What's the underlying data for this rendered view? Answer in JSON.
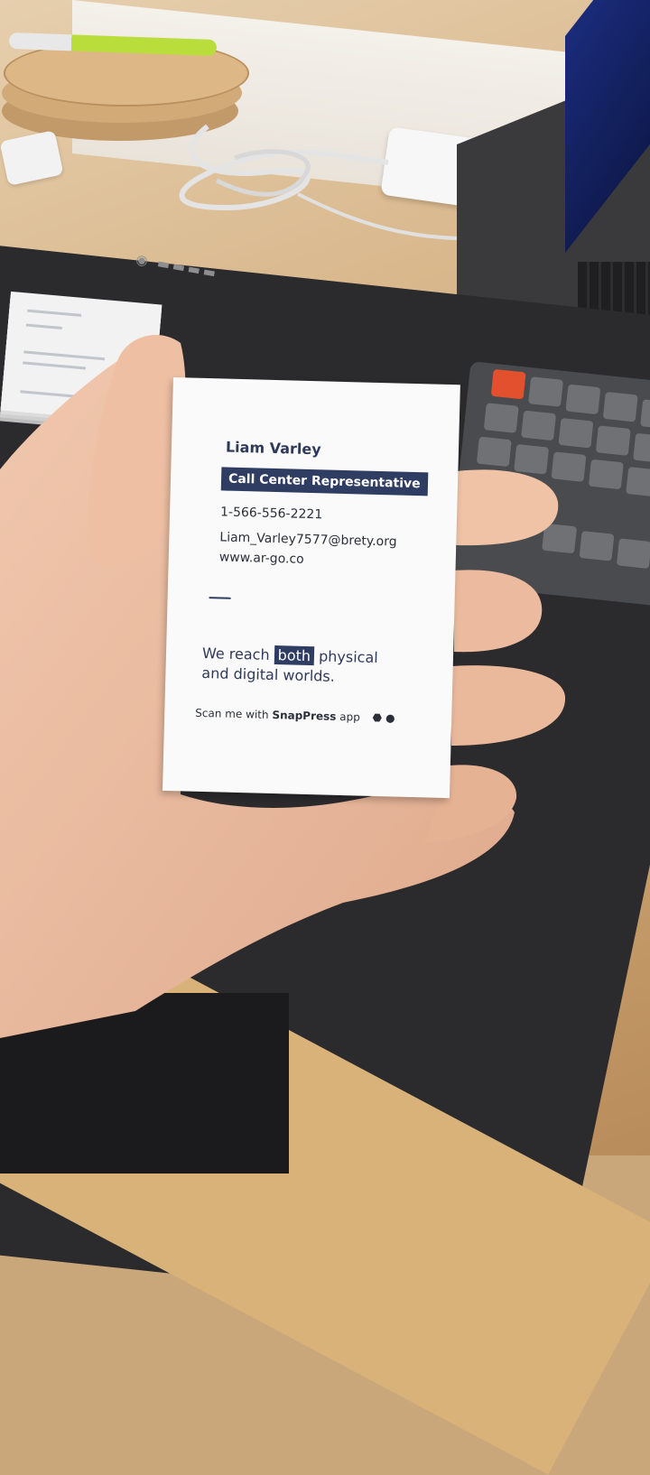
{
  "card": {
    "name": "Liam Varley",
    "title": "Call Center Representative",
    "phone": "1-566-556-2221",
    "email": "Liam_Varley7577@brety.org",
    "website": "www.ar-go.co",
    "tagline_before": "We reach",
    "tagline_highlight": "both",
    "tagline_after_line1": "physical",
    "tagline_line2": "and digital worlds.",
    "scan_prefix": "Scan me with",
    "scan_app": "SnapPress",
    "scan_suffix": "app"
  },
  "icons": {
    "android": "android-icon",
    "apple": "apple-icon"
  },
  "colors": {
    "card_accent": "#2f3d63",
    "card_bg": "#fafafa",
    "mat": "#2b2a2c",
    "desk": "#d9b88d",
    "keyboard_accent_key": "#e2502e"
  }
}
